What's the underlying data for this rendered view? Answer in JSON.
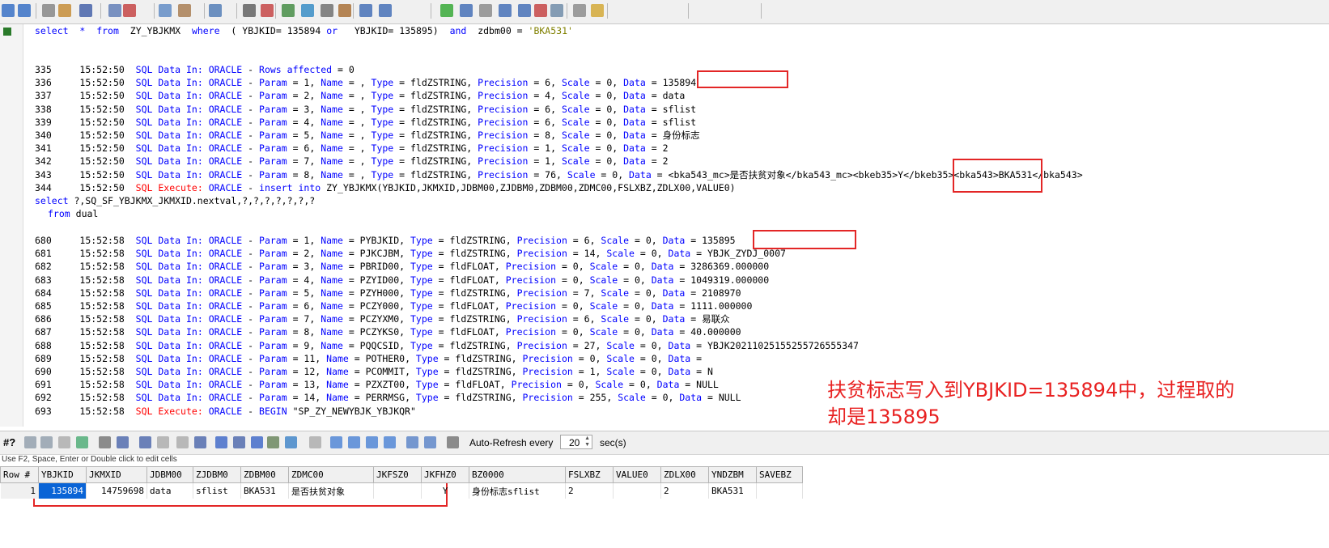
{
  "toolbar": {
    "icons": [
      "back-icon",
      "forward-icon",
      "new-icon",
      "open-icon",
      "save-icon",
      "print-icon",
      "cut-icon",
      "copy-icon",
      "paste-icon",
      "find-icon",
      "filter-icon",
      "clear-filter-icon",
      "execute-icon",
      "refresh-icon",
      "zoom-icon",
      "bookmark-icon",
      "first-icon",
      "prev-icon",
      "play-icon",
      "next-icon",
      "stop-icon",
      "last-icon",
      "end-icon",
      "settings-icon",
      "table-icon",
      "chart-icon",
      "help-icon"
    ]
  },
  "editor": {
    "line1": {
      "select": "select",
      "star": "*",
      "from": "from",
      "table": "ZY_YBJKMX",
      "where": "where",
      "p1": "(",
      "c1": "YBJKID=",
      "v1": "135894",
      "or": "or",
      "c2": "YBJKID=",
      "v2": "135895)",
      "and": "and",
      "c3": "zdbm00 =",
      "v3": "'BKA531'"
    },
    "g1": [
      {
        "n": "335",
        "t": "15:52:50",
        "msg": "SQL Data In:",
        "db": "ORACLE",
        "rest": "- Rows affected = 0"
      },
      {
        "n": "336",
        "t": "15:52:50",
        "msg": "SQL Data In:",
        "db": "ORACLE",
        "rest": "- Param = 1, Name = , Type = fldZSTRING, Precision = 6, Scale = 0, Data = 135894"
      },
      {
        "n": "337",
        "t": "15:52:50",
        "msg": "SQL Data In:",
        "db": "ORACLE",
        "rest": "- Param = 2, Name = , Type = fldZSTRING, Precision = 4, Scale = 0, Data = data"
      },
      {
        "n": "338",
        "t": "15:52:50",
        "msg": "SQL Data In:",
        "db": "ORACLE",
        "rest": "- Param = 3, Name = , Type = fldZSTRING, Precision = 6, Scale = 0, Data = sflist"
      },
      {
        "n": "339",
        "t": "15:52:50",
        "msg": "SQL Data In:",
        "db": "ORACLE",
        "rest": "- Param = 4, Name = , Type = fldZSTRING, Precision = 6, Scale = 0, Data = sflist"
      },
      {
        "n": "340",
        "t": "15:52:50",
        "msg": "SQL Data In:",
        "db": "ORACLE",
        "rest": "- Param = 5, Name = , Type = fldZSTRING, Precision = 8, Scale = 0, Data = 身份标志"
      },
      {
        "n": "341",
        "t": "15:52:50",
        "msg": "SQL Data In:",
        "db": "ORACLE",
        "rest": "- Param = 6, Name = , Type = fldZSTRING, Precision = 1, Scale = 0, Data = 2"
      },
      {
        "n": "342",
        "t": "15:52:50",
        "msg": "SQL Data In:",
        "db": "ORACLE",
        "rest": "- Param = 7, Name = , Type = fldZSTRING, Precision = 1, Scale = 0, Data = 2"
      },
      {
        "n": "343",
        "t": "15:52:50",
        "msg": "SQL Data In:",
        "db": "ORACLE",
        "rest": "- Param = 8, Name = , Type = fldZSTRING, Precision = 76, Scale = 0, Data = <bka543_mc>是否扶贫对象</bka543_mc><bkeb35>Y</bkeb35><bka543>BKA531</bka543>"
      },
      {
        "n": "344",
        "t": "15:52:50",
        "msg": "SQL Execute:",
        "db": "ORACLE",
        "rest": "- insert into ZY_YBJKMX(YBJKID,JKMXID,JDBM00,ZJDBM0,ZDBM00,ZDMC00,FSLXBZ,ZDLX00,VALUE0)"
      }
    ],
    "sel_line": "select ?,SQ_SF_YBJKMX_JKMXID.nextval,?,?,?,?,?,?,?",
    "from_line": {
      "from": "from",
      "dual": "dual"
    },
    "g2": [
      {
        "n": "680",
        "t": "15:52:58",
        "msg": "SQL Data In:",
        "db": "ORACLE",
        "rest": "- Param = 1, Name = PYBJKID, Type = fldZSTRING, Precision = 6, Scale = 0, Data = 135895"
      },
      {
        "n": "681",
        "t": "15:52:58",
        "msg": "SQL Data In:",
        "db": "ORACLE",
        "rest": "- Param = 2, Name = PJKCJBM, Type = fldZSTRING, Precision = 14, Scale = 0, Data = YBJK_ZYDJ_0007"
      },
      {
        "n": "682",
        "t": "15:52:58",
        "msg": "SQL Data In:",
        "db": "ORACLE",
        "rest": "- Param = 3, Name = PBRID00, Type = fldFLOAT, Precision = 0, Scale = 0, Data = 3286369.000000"
      },
      {
        "n": "683",
        "t": "15:52:58",
        "msg": "SQL Data In:",
        "db": "ORACLE",
        "rest": "- Param = 4, Name = PZYID00, Type = fldFLOAT, Precision = 0, Scale = 0, Data = 1049319.000000"
      },
      {
        "n": "684",
        "t": "15:52:58",
        "msg": "SQL Data In:",
        "db": "ORACLE",
        "rest": "- Param = 5, Name = PZYH000, Type = fldZSTRING, Precision = 7, Scale = 0, Data = 2108970"
      },
      {
        "n": "685",
        "t": "15:52:58",
        "msg": "SQL Data In:",
        "db": "ORACLE",
        "rest": "- Param = 6, Name = PCZY000, Type = fldFLOAT, Precision = 0, Scale = 0, Data = 1111.000000"
      },
      {
        "n": "686",
        "t": "15:52:58",
        "msg": "SQL Data In:",
        "db": "ORACLE",
        "rest": "- Param = 7, Name = PCZYXM0, Type = fldZSTRING, Precision = 6, Scale = 0, Data = 易联众"
      },
      {
        "n": "687",
        "t": "15:52:58",
        "msg": "SQL Data In:",
        "db": "ORACLE",
        "rest": "- Param = 8, Name = PCZYKS0, Type = fldFLOAT, Precision = 0, Scale = 0, Data = 40.000000"
      },
      {
        "n": "688",
        "t": "15:52:58",
        "msg": "SQL Data In:",
        "db": "ORACLE",
        "rest": "- Param = 9, Name = PQQCSID, Type = fldZSTRING, Precision = 27, Scale = 0, Data = YBJK20211025155255726555347"
      },
      {
        "n": "689",
        "t": "15:52:58",
        "msg": "SQL Data In:",
        "db": "ORACLE",
        "rest": "- Param = 11, Name = POTHER0, Type = fldZSTRING, Precision = 0, Scale = 0, Data ="
      },
      {
        "n": "690",
        "t": "15:52:58",
        "msg": "SQL Data In:",
        "db": "ORACLE",
        "rest": "- Param = 12, Name = PCOMMIT, Type = fldZSTRING, Precision = 1, Scale = 0, Data = N"
      },
      {
        "n": "691",
        "t": "15:52:58",
        "msg": "SQL Data In:",
        "db": "ORACLE",
        "rest": "- Param = 13, Name = PZXZT00, Type = fldFLOAT, Precision = 0, Scale = 0, Data = NULL"
      },
      {
        "n": "692",
        "t": "15:52:58",
        "msg": "SQL Data In:",
        "db": "ORACLE",
        "rest": "- Param = 14, Name = PERRMSG, Type = fldZSTRING, Precision = 255, Scale = 0, Data = NULL"
      },
      {
        "n": "693",
        "t": "15:52:58",
        "msg": "SQL Execute:",
        "db": "ORACLE",
        "rest": "- BEGIN \"SP_ZY_NEWYBJK_YBJKQR\""
      }
    ]
  },
  "annotation": {
    "text": "扶贫标志写入到YBJKID=135894中，过程取的\n却是135895"
  },
  "gridbar": {
    "auto_refresh_label": "Auto-Refresh every",
    "interval": "20",
    "unit": "sec(s)",
    "hash_label": "#?"
  },
  "status": "Use F2, Space, Enter or Double click to edit cells",
  "grid": {
    "columns": [
      "Row #",
      "YBJKID",
      "JKMXID",
      "JDBM00",
      "ZJDBM0",
      "ZDBM00",
      "ZDMC00",
      "JKFSZ0",
      "JKFHZ0",
      "BZ0000",
      "FSLXBZ",
      "VALUE0",
      "ZDLX00",
      "YNDZBM",
      "SAVEBZ"
    ],
    "rows": [
      [
        "1",
        "135894",
        "14759698",
        "data",
        "sflist",
        "BKA531",
        "是否扶贫对象",
        "",
        "Y",
        "身份标志sflist",
        "2",
        "",
        "2",
        "BKA531",
        ""
      ]
    ]
  }
}
